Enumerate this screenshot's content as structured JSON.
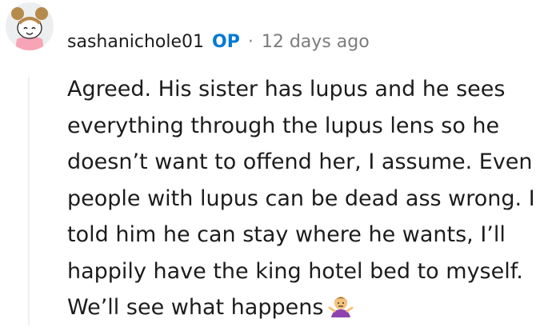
{
  "comment": {
    "author": "sashanichole01",
    "op_badge": "OP",
    "separator": "·",
    "timestamp": "12 days ago",
    "lines": [
      "Agreed. His sister has lupus and he sees",
      "everything through the lupus lens so he",
      "doesn’t want to offend her, I assume. Even",
      "people with lupus can be dead ass wrong. I",
      "told him he can stay where he wants, I’ll",
      "happily have the king hotel bed to myself.",
      "We’ll see what happens"
    ],
    "emoji": "person-shrugging-emoji",
    "colors": {
      "op_badge": "#0079d3",
      "meta_text": "#7c7c7c",
      "body_text": "#1c1c1c"
    }
  }
}
